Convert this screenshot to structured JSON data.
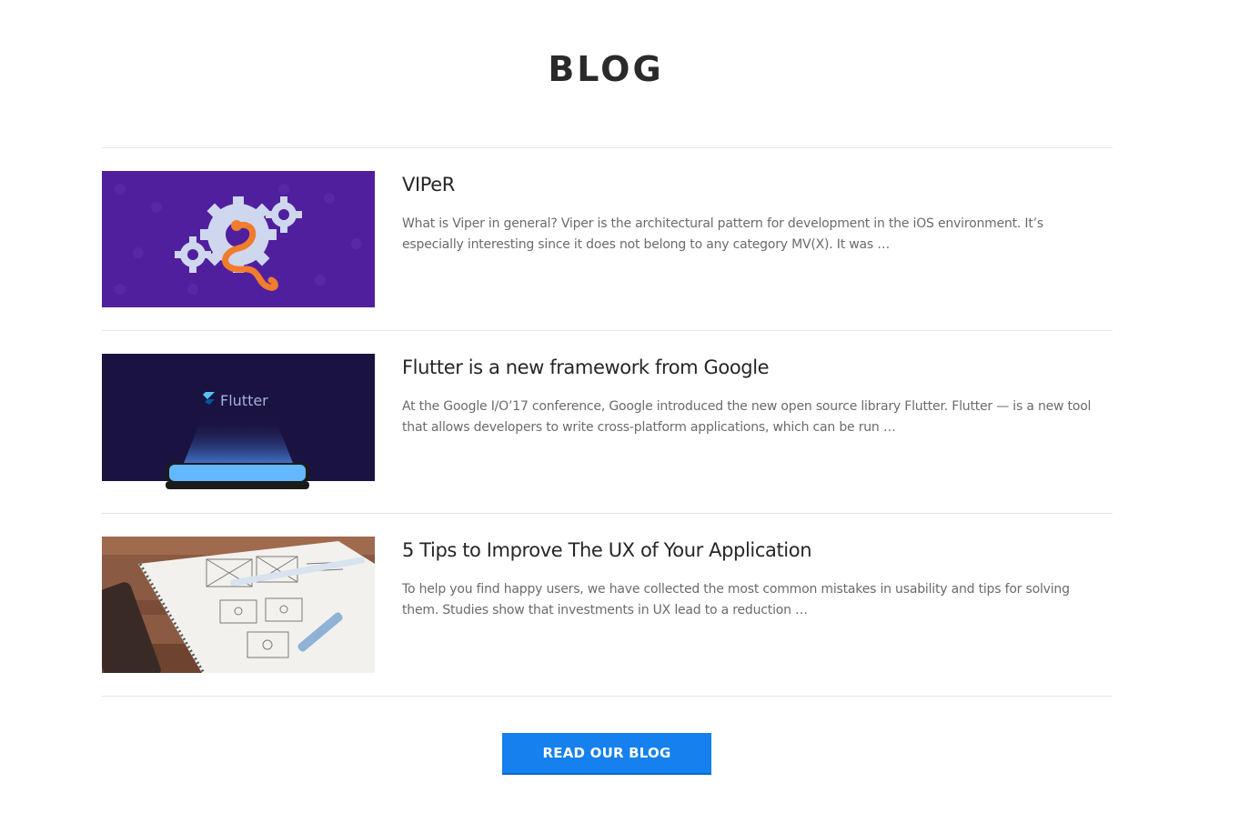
{
  "section": {
    "title": "BLOG"
  },
  "posts": [
    {
      "title": "VIPeR",
      "excerpt": "What is Viper in general? Viper is the architectural pattern for development in the iOS environment. It’s especially interesting since it does not belong to any category MV(X). It was …",
      "image_icon": "gears-snake-illustration"
    },
    {
      "title": "Flutter is a new framework from Google",
      "excerpt": "At the Google I/O’17 conference, Google introduced the new open source library Flutter. Flutter — is a new tool that allows developers to write cross-platform applications, which can be run …",
      "image_icon": "flutter-phone-illustration",
      "image_text": "Flutter"
    },
    {
      "title": "5 Tips to Improve The UX of Your Application",
      "excerpt": "To help you find happy users, we have collected the most common mistakes in usability and tips for solving them. Studies show that investments in UX lead to a reduction …",
      "image_icon": "wireframe-sketch-photo"
    }
  ],
  "cta": {
    "label": "READ OUR BLOG"
  },
  "colors": {
    "accent": "#1580ee",
    "viper_bg": "#4f1f9e",
    "flutter_bg": "#1a1240",
    "divider": "#e6e6e6"
  }
}
